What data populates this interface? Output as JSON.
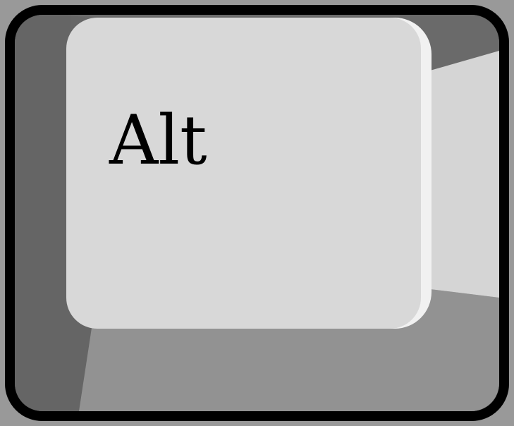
{
  "key": {
    "label": "Alt",
    "icon": "keyboard-key-icon"
  },
  "colors": {
    "background": "#999999",
    "outline": "#000000",
    "well_left": "#666666",
    "well_top": "#6b6b6b",
    "well_bottom": "#919191",
    "well_right": "#d5d5d5",
    "keycap_face": "#d7d7d7",
    "keycap_edge": "#f2f2f2",
    "label": "#000000"
  }
}
